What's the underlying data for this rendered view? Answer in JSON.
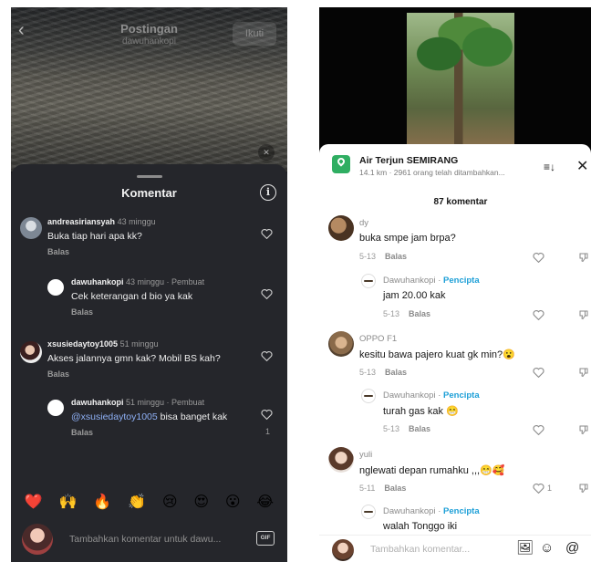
{
  "left": {
    "header": {
      "title": "Postingan",
      "subtitle": "dawuhankopi",
      "follow_label": "Ikuti"
    },
    "sheet": {
      "title": "Komentar",
      "comments": [
        {
          "user": "andreasiriansyah",
          "time": "43 minggu",
          "text": "Buka tiap hari apa kk?",
          "reply": "Balas"
        },
        {
          "user": "dawuhankopi",
          "time": "43 minggu · Pembuat",
          "text": "Cek keterangan d bio ya kak",
          "reply": "Balas"
        },
        {
          "user": "xsusiedaytoy1005",
          "time": "51 minggu",
          "text": "Akses jalannya gmn kak? Mobil BS kah?",
          "reply": "Balas"
        },
        {
          "user": "dawuhankopi",
          "time": "51 minggu · Pembuat",
          "mention": "@xsusiedaytoy1005",
          "text": " bisa banget kak",
          "reply": "Balas",
          "likes": "1"
        }
      ],
      "emojis": [
        "❤️",
        "🙌",
        "🔥",
        "👏",
        "😢",
        "😍",
        "😮",
        "😂"
      ],
      "input_placeholder": "Tambahkan komentar untuk dawu...",
      "gif_label": "GIF"
    }
  },
  "right": {
    "location": {
      "name": "Air Terjun SEMIRANG",
      "sub": "14.1 km · 2961 orang telah ditambahkan..."
    },
    "comment_count": "87 komentar",
    "comments": [
      {
        "user": "dy",
        "text": "buka smpe jam brpa?",
        "date": "5-13",
        "reply": "Balas"
      },
      {
        "user": "Dawuhankopi",
        "creator": "Pencipta",
        "text": "jam 20.00 kak",
        "date": "5-13",
        "reply": "Balas"
      },
      {
        "user": "OPPO F1",
        "text": "kesitu bawa pajero kuat gk min?😮",
        "date": "5-13",
        "reply": "Balas"
      },
      {
        "user": "Dawuhankopi",
        "creator": "Pencipta",
        "text": "turah gas kak 😁",
        "date": "5-13",
        "reply": "Balas"
      },
      {
        "user": "yuli",
        "text": "nglewati depan rumahku ,,,😁🥰",
        "date": "5-11",
        "reply": "Balas",
        "likes": "1"
      },
      {
        "user": "Dawuhankopi",
        "creator": "Pencipta",
        "text": "walah Tonggo iki"
      }
    ],
    "input_placeholder": "Tambahkan komentar..."
  }
}
